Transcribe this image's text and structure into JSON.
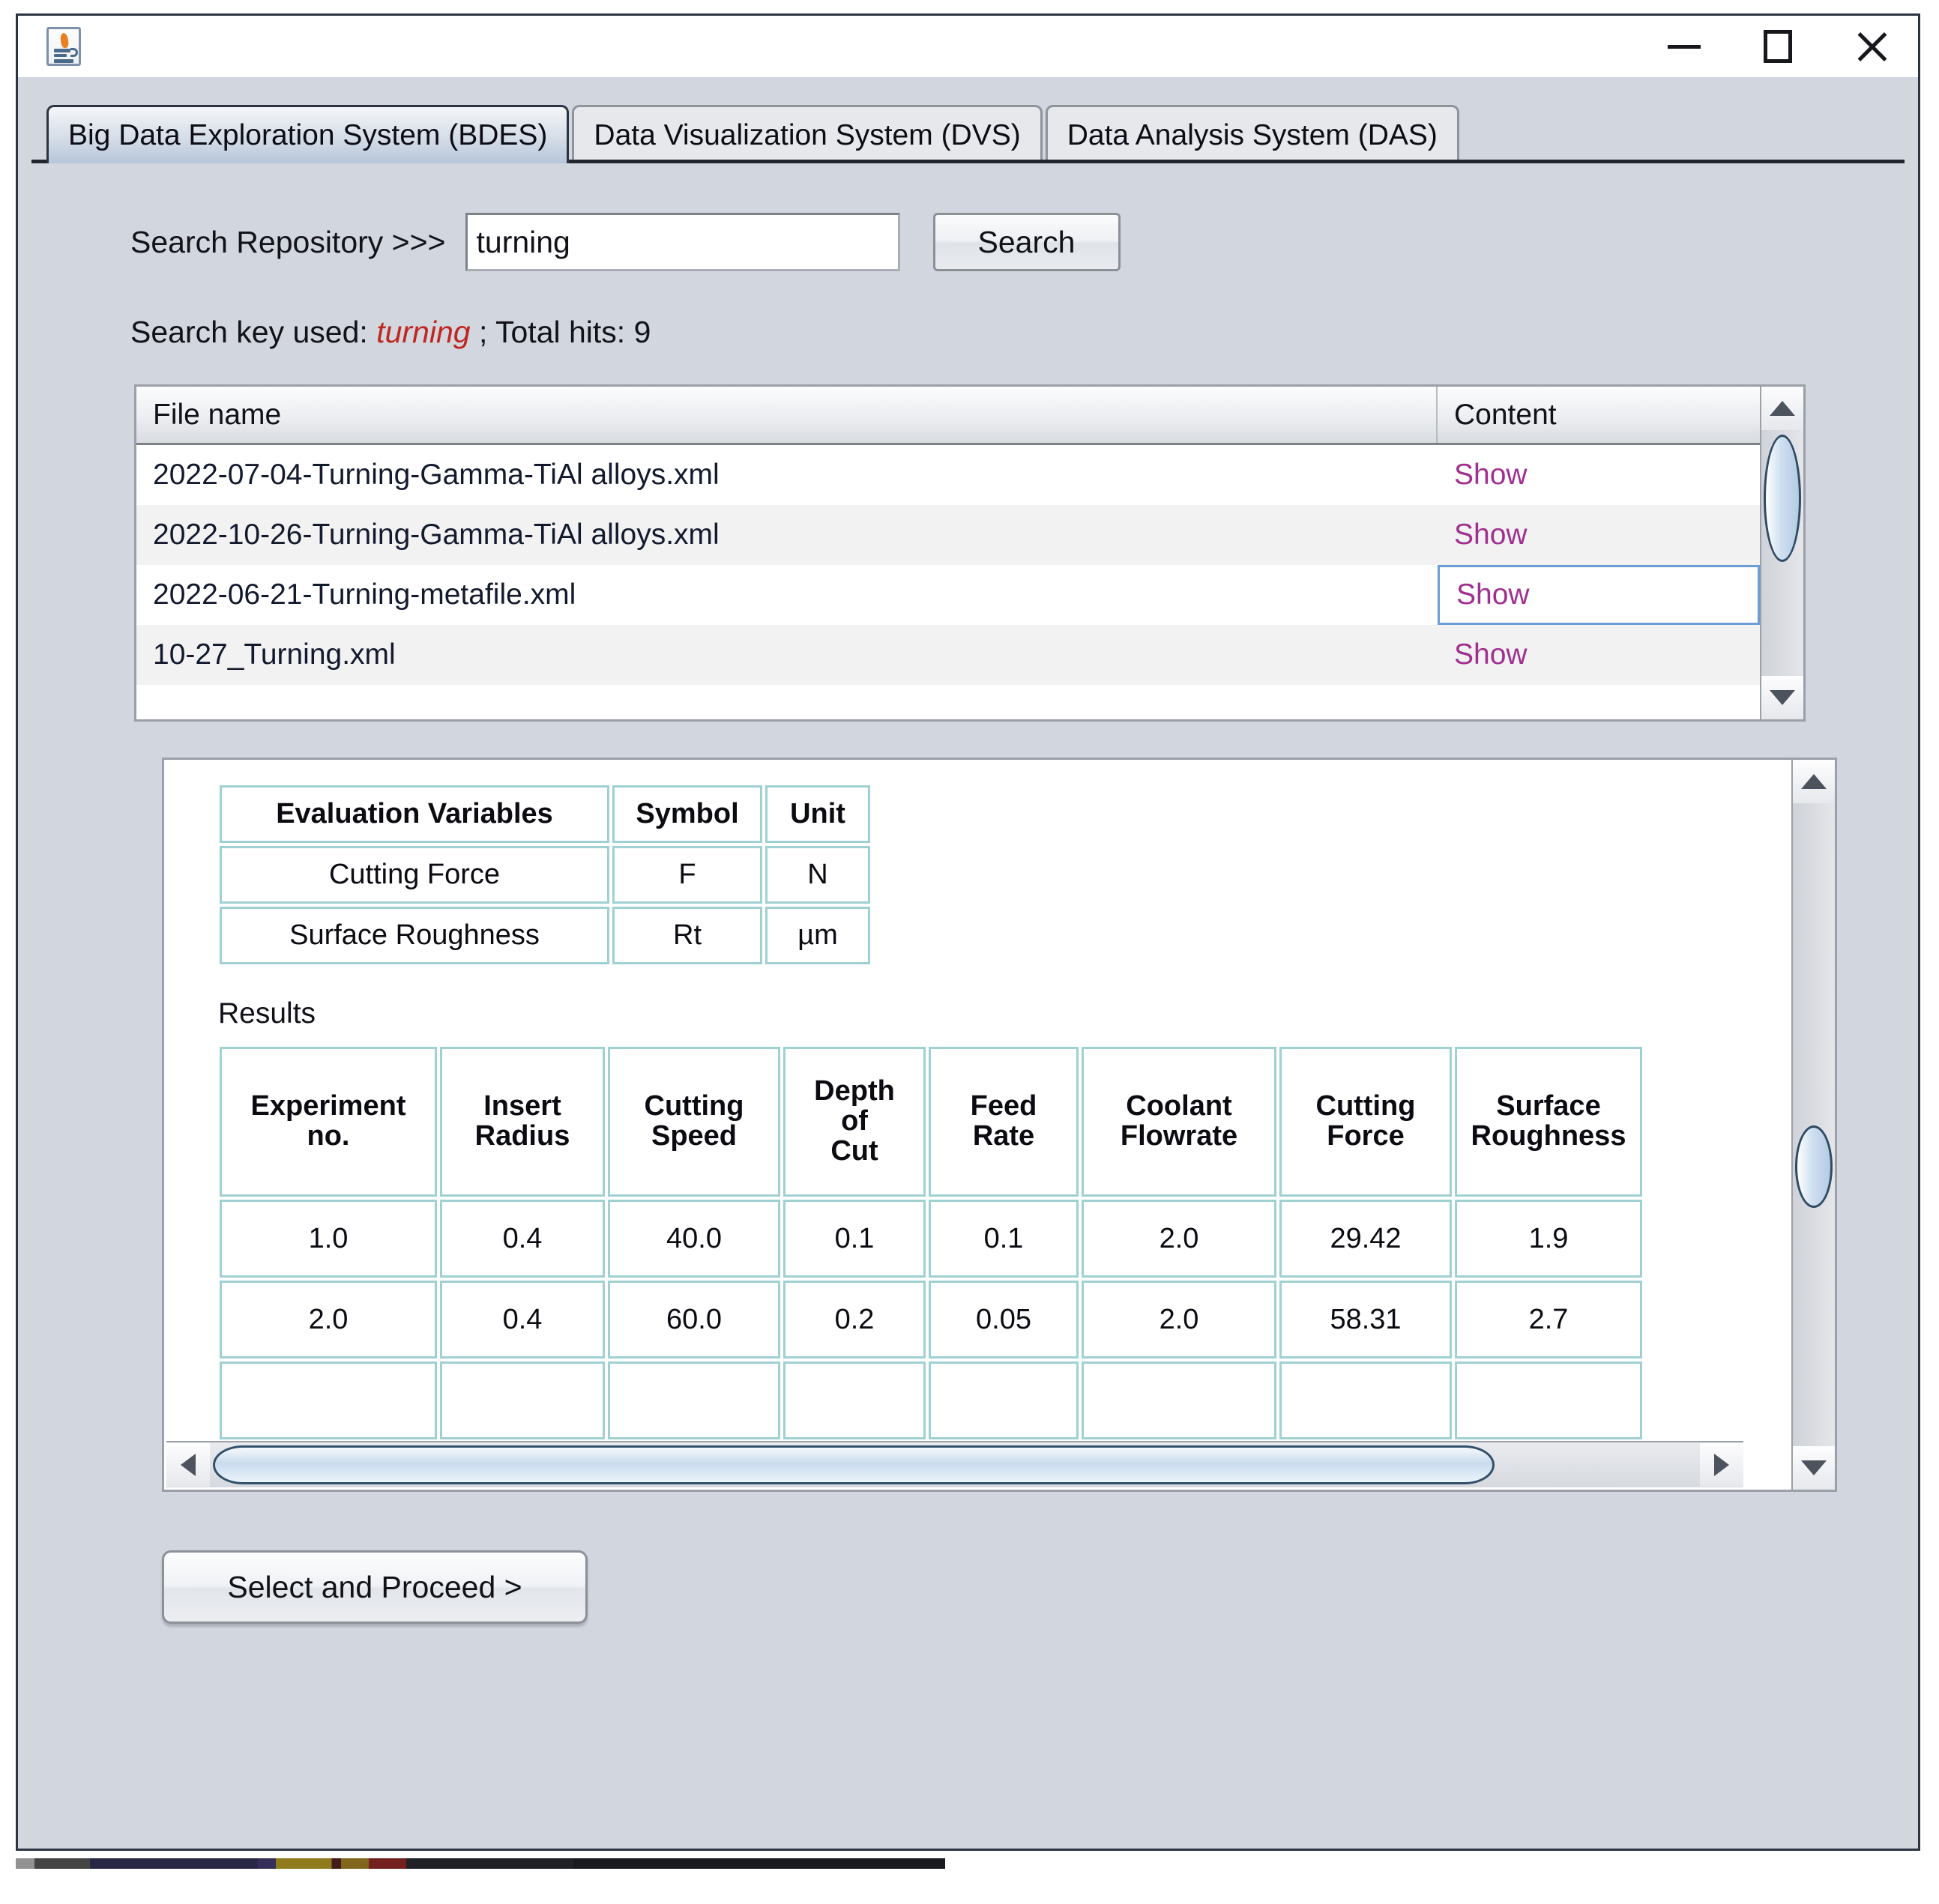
{
  "window": {
    "app_icon": "java-coffee-cup-icon",
    "controls": {
      "minimize": "minimize-icon",
      "maximize": "maximize-icon",
      "close": "close-icon"
    }
  },
  "tabs": [
    {
      "label": "Big Data Exploration System (BDES)",
      "active": true
    },
    {
      "label": "Data Visualization System (DVS)",
      "active": false
    },
    {
      "label": "Data Analysis System (DAS)",
      "active": false
    }
  ],
  "search": {
    "label": "Search Repository >>>",
    "value": "turning",
    "placeholder": "",
    "button_label": "Search"
  },
  "status": {
    "prefix": "Search key used: ",
    "key": "turning",
    "suffix": " ; Total hits: 9"
  },
  "file_table": {
    "columns": [
      "File name",
      "Content"
    ],
    "rows": [
      {
        "file": "2022-07-04-Turning-Gamma-TiAl alloys.xml",
        "content": "Show",
        "focused": false
      },
      {
        "file": "2022-10-26-Turning-Gamma-TiAl alloys.xml",
        "content": "Show",
        "focused": false
      },
      {
        "file": "2022-06-21-Turning-metafile.xml",
        "content": "Show",
        "focused": true
      },
      {
        "file": "10-27_Turning.xml",
        "content": "Show",
        "focused": false
      }
    ]
  },
  "evaluation_table": {
    "headers": [
      "Evaluation Variables",
      "Symbol",
      "Unit"
    ],
    "rows": [
      [
        "Cutting Force",
        "F",
        "N"
      ],
      [
        "Surface Roughness",
        "Rt",
        "µm"
      ]
    ]
  },
  "results": {
    "title": "Results",
    "headers": [
      "Experiment no.",
      "Insert Radius",
      "Cutting Speed",
      "Depth of Cut",
      "Feed Rate",
      "Coolant Flowrate",
      "Cutting Force",
      "Surface Roughness"
    ],
    "header_lines": [
      [
        "Experiment",
        "no."
      ],
      [
        "Insert",
        "Radius"
      ],
      [
        "Cutting",
        "Speed"
      ],
      [
        "Depth",
        "of",
        "Cut"
      ],
      [
        "Feed",
        "Rate"
      ],
      [
        "Coolant",
        "Flowrate"
      ],
      [
        "Cutting",
        "Force"
      ],
      [
        "Surface",
        "Roughness"
      ]
    ],
    "rows": [
      [
        "1.0",
        "0.4",
        "40.0",
        "0.1",
        "0.1",
        "2.0",
        "29.42",
        "1.9"
      ],
      [
        "2.0",
        "0.4",
        "60.0",
        "0.2",
        "0.05",
        "2.0",
        "58.31",
        "2.7"
      ]
    ]
  },
  "footer": {
    "proceed_label": "Select and Proceed >"
  },
  "colors": {
    "window_bg": "#d2d6de",
    "frame": "#2b3440",
    "link": "#a0308f",
    "keyword": "#c0261f",
    "table_border": "#9fd0d2",
    "focus_border": "#6b9ed6"
  }
}
